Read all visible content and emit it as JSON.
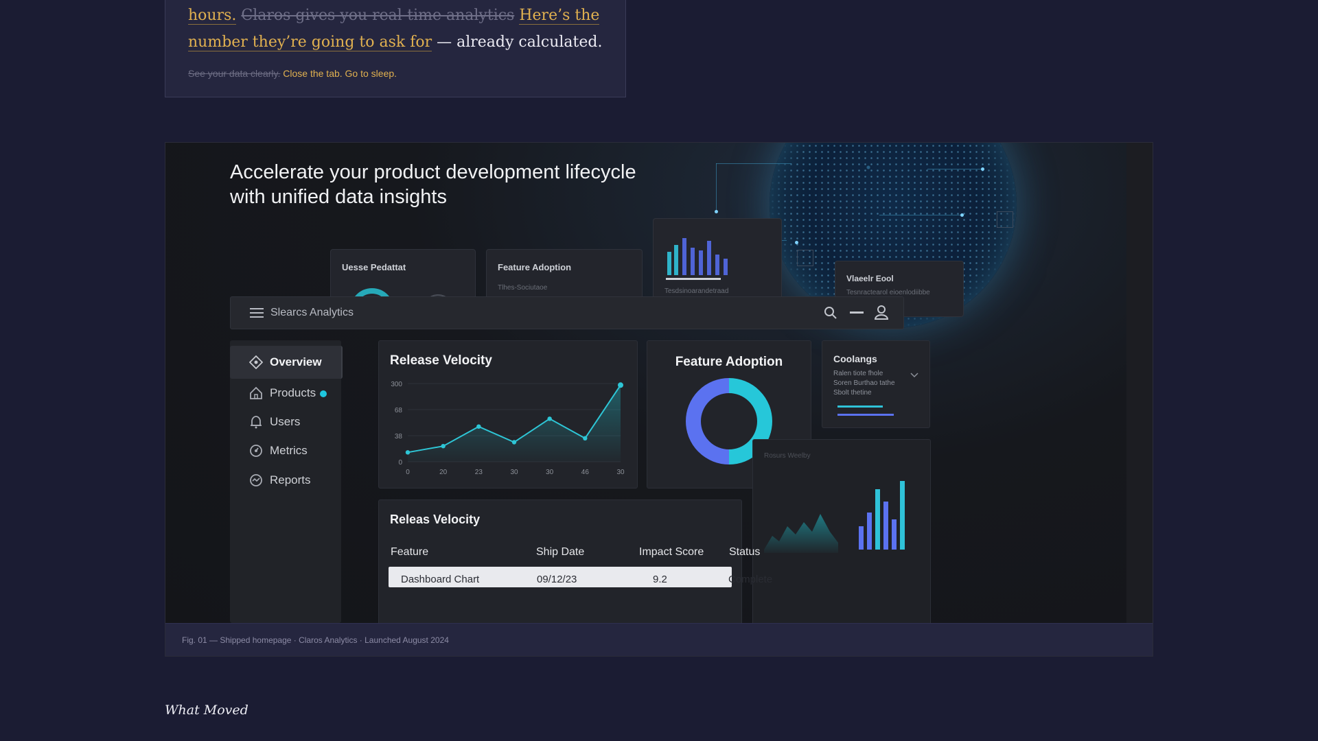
{
  "quote": {
    "main_1": "hours.",
    "struck_1": "Claros gives you real-time analytics",
    "highlight_1": "Here’s the number they’re going to ask for",
    "main_2": "— already calculated.",
    "small_struck": "See your data clearly.",
    "small_highlight": "Close the tab. Go to sleep."
  },
  "figure": {
    "hero_line_1": "Accelerate your product development lifecycle",
    "hero_line_2": "with unified data insights",
    "back_cards": [
      {
        "title": "Uesse Pedattat",
        "sub": ""
      },
      {
        "title": "Feature Adoption",
        "sub": "Tlhes-Sociutaoe"
      },
      {
        "title": "",
        "sub": "Tesdsinoarandetraad"
      },
      {
        "title": "Vlaeelr Eool",
        "sub": "Tesnractearol eioenlodiibbe"
      }
    ],
    "app_title": "Slearcs Analytics",
    "nav": [
      {
        "label": "Overview",
        "icon": "diamond-icon"
      },
      {
        "label": "Products",
        "icon": "home-icon"
      },
      {
        "label": "Users",
        "icon": "bell-icon"
      },
      {
        "label": "Metrics",
        "icon": "gauge-icon"
      },
      {
        "label": "Reports",
        "icon": "report-icon"
      }
    ],
    "release_panel_title": "Release Velocity",
    "adoption_panel_title": "Feature Adoption",
    "cool_panel": {
      "title": "Coolangs",
      "text_1": "Ralen tiote fhole",
      "text_2": "Soren Burthao tathe",
      "text_3": "Sbolt thetine"
    },
    "weekly_panel_title": "Rosurs Weelby",
    "table_panel": {
      "title": "Releas Velocity",
      "headers": [
        "Feature",
        "Ship Date",
        "Impact Score",
        "Status"
      ],
      "row": [
        "Dashboard Chart",
        "09/12/23",
        "9.2",
        "Complete"
      ]
    },
    "caption": "Fig. 01 — Shipped homepage · Claros Analytics · Launched August 2024"
  },
  "section_heading": "What Moved",
  "colors": {
    "accent_gold": "#e1b150",
    "teal": "#26c7d9",
    "blue": "#5b72f0",
    "page_bg": "#1b1c33"
  },
  "chart_data": [
    {
      "type": "line",
      "title": "Release Velocity",
      "x_tick_labels": [
        "0",
        "20",
        "23",
        "30",
        "30",
        "46",
        "30"
      ],
      "y_tick_labels": [
        "0",
        "38",
        "68",
        "300"
      ],
      "values": [
        12,
        20,
        45,
        25,
        55,
        30,
        98
      ],
      "ylim": [
        0,
        100
      ],
      "grid": true
    },
    {
      "type": "pie",
      "title": "Feature Adoption",
      "categories": [
        "teal",
        "blue"
      ],
      "values": [
        0.5,
        0.5
      ]
    }
  ]
}
